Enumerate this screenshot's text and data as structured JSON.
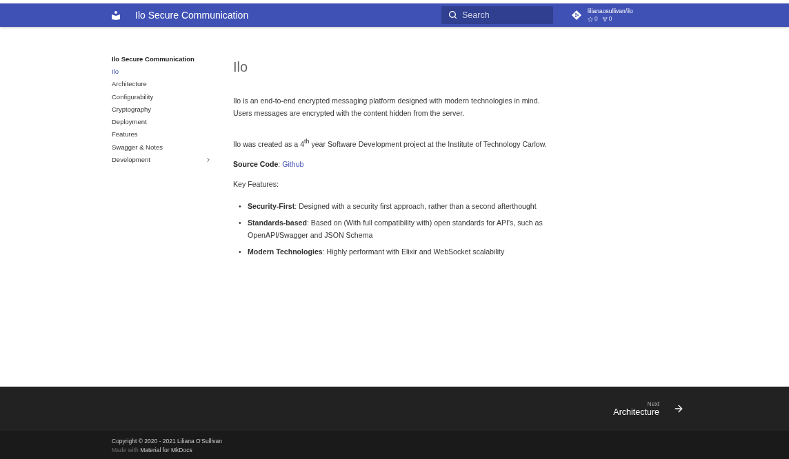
{
  "header": {
    "title": "Ilo Secure Communication",
    "search": {
      "placeholder": "Search"
    },
    "repo": {
      "name": "lilianaosullivan/ilo",
      "stars": "0",
      "forks": "0"
    }
  },
  "sidebar": {
    "title": "Ilo Secure Communication",
    "items": [
      {
        "label": "Ilo",
        "selected": true,
        "kind": "page"
      },
      {
        "label": "Architecture",
        "selected": false,
        "kind": "page"
      },
      {
        "label": "Configurability",
        "selected": false,
        "kind": "page"
      },
      {
        "label": "Cryptography",
        "selected": false,
        "kind": "page"
      },
      {
        "label": "Deployment",
        "selected": false,
        "kind": "page"
      },
      {
        "label": "Features",
        "selected": false,
        "kind": "page"
      },
      {
        "label": "Swagger & Notes",
        "selected": false,
        "kind": "page"
      },
      {
        "label": "Development",
        "selected": false,
        "kind": "section"
      }
    ]
  },
  "article": {
    "heading": "Ilo",
    "paragraphs": [
      "Ilo is an end-to-end encrypted messaging platform designed with modern technologies in mind. Users messages are encrypted with the content hidden from the server.",
      "Ilo was created as a 4$^{th}$ year Software Development project at the Institute of Technology Carlow."
    ],
    "source": {
      "label": "Source Code",
      "separator": ":",
      "link": "Github"
    },
    "features_intro": "Key Features:",
    "features": [
      {
        "bullet": "•",
        "text": "**Security-First**: Designed with a security first approach, rather than a second afterthought"
      },
      {
        "bullet": "•",
        "text": "**Standards-based**: Based on (With full compatibility with) open standards for API's, such as OpenAPI/Swagger and JSON Schema"
      },
      {
        "bullet": "•",
        "text": "**Modern Technologies**: Highly performant with Elixir and WebSocket scalability"
      }
    ]
  },
  "footer": {
    "next": {
      "caption": "Next",
      "title": "Architecture"
    },
    "copyright": "Copyright © 2020 - 2021 Liliana O'Sullivan",
    "made_with": "Made with",
    "made_with_link": "Material for MkDocs"
  }
}
